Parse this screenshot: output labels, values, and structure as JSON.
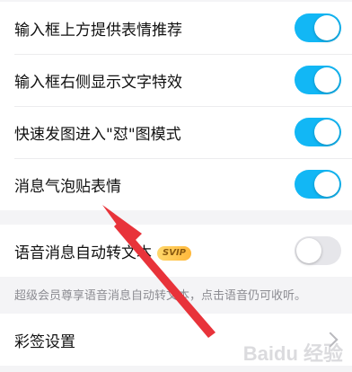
{
  "settings_group": {
    "items": [
      {
        "label": "输入框上方提供表情推荐",
        "enabled": true
      },
      {
        "label": "输入框右侧显示文字特效",
        "enabled": true
      },
      {
        "label": "快速发图进入\"怼\"图模式",
        "enabled": true
      },
      {
        "label": "消息气泡贴表情",
        "enabled": true
      }
    ]
  },
  "voice_group": {
    "label": "语音消息自动转文本",
    "badge": "SVIP",
    "enabled": false,
    "note": "超级会员尊享语音消息自动转文本，点击语音仍可收听。"
  },
  "caiqian": {
    "label": "彩签设置",
    "icon": "chevron-right-icon"
  },
  "watermark": "Baidu 经验",
  "colors": {
    "toggle_on": "#12b7f5",
    "toggle_off": "#e6e6ea",
    "annotation_arrow": "#e8333a"
  }
}
